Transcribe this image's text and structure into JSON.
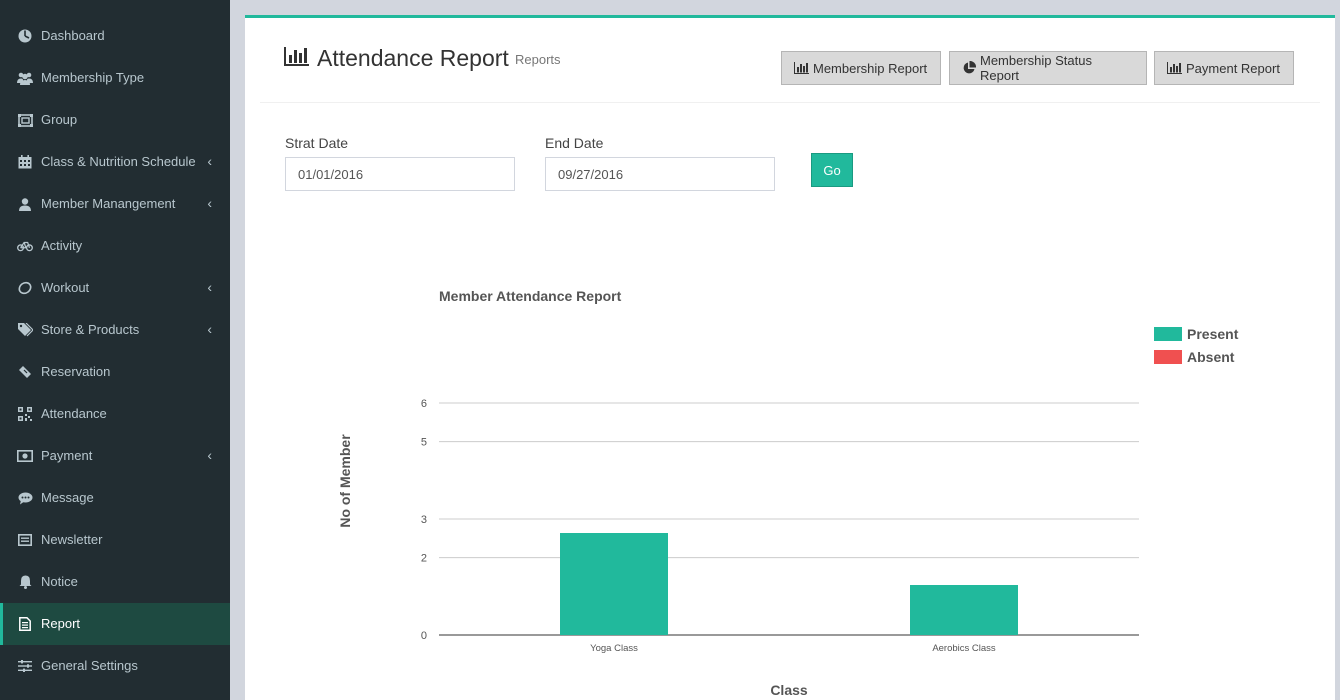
{
  "sidebar": {
    "items": [
      {
        "label": "Dashboard",
        "icon": "dashboard-icon",
        "chevron": false,
        "active": false
      },
      {
        "label": "Membership Type",
        "icon": "users-icon",
        "chevron": false,
        "active": false
      },
      {
        "label": "Group",
        "icon": "group-icon",
        "chevron": false,
        "active": false
      },
      {
        "label": "Class & Nutrition Schedule",
        "icon": "calendar-icon",
        "chevron": true,
        "active": false
      },
      {
        "label": "Member Manangement",
        "icon": "user-icon",
        "chevron": true,
        "active": false
      },
      {
        "label": "Activity",
        "icon": "bicycle-icon",
        "chevron": false,
        "active": false
      },
      {
        "label": "Workout",
        "icon": "lemon-icon",
        "chevron": true,
        "active": false
      },
      {
        "label": "Store & Products",
        "icon": "tags-icon",
        "chevron": true,
        "active": false
      },
      {
        "label": "Reservation",
        "icon": "ticket-icon",
        "chevron": false,
        "active": false
      },
      {
        "label": "Attendance",
        "icon": "qrcode-icon",
        "chevron": false,
        "active": false
      },
      {
        "label": "Payment",
        "icon": "money-icon",
        "chevron": true,
        "active": false
      },
      {
        "label": "Message",
        "icon": "comment-icon",
        "chevron": false,
        "active": false
      },
      {
        "label": "Newsletter",
        "icon": "envelope-icon",
        "chevron": false,
        "active": false
      },
      {
        "label": "Notice",
        "icon": "bell-icon",
        "chevron": false,
        "active": false
      },
      {
        "label": "Report",
        "icon": "file-text-icon",
        "chevron": false,
        "active": true
      },
      {
        "label": "General Settings",
        "icon": "sliders-icon",
        "chevron": false,
        "active": false
      }
    ]
  },
  "header": {
    "title": "Attendance Report",
    "subtitle": "Reports",
    "buttons": {
      "membership_report": "Membership Report",
      "membership_status_report": "Membership Status Report",
      "payment_report": "Payment Report"
    }
  },
  "filters": {
    "start_label": "Strat Date",
    "start_value": "01/01/2016",
    "end_label": "End Date",
    "end_value": "09/27/2016",
    "go_label": "Go"
  },
  "colors": {
    "accent": "#21b99c",
    "present": "#21b99c",
    "absent": "#f05050",
    "sidebar_bg": "#222d32"
  },
  "chart_data": {
    "type": "bar",
    "title": "Member Attendance Report",
    "xlabel": "Class",
    "ylabel": "No of Member",
    "categories": [
      "Yoga Class",
      "Aerobics Class"
    ],
    "series": [
      {
        "name": "Present",
        "values": [
          2,
          1
        ]
      },
      {
        "name": "Absent",
        "values": [
          0,
          0
        ]
      }
    ],
    "y_ticks": [
      "0",
      "2",
      "3",
      "5",
      "6"
    ],
    "legend_position": "right",
    "grid": true
  }
}
